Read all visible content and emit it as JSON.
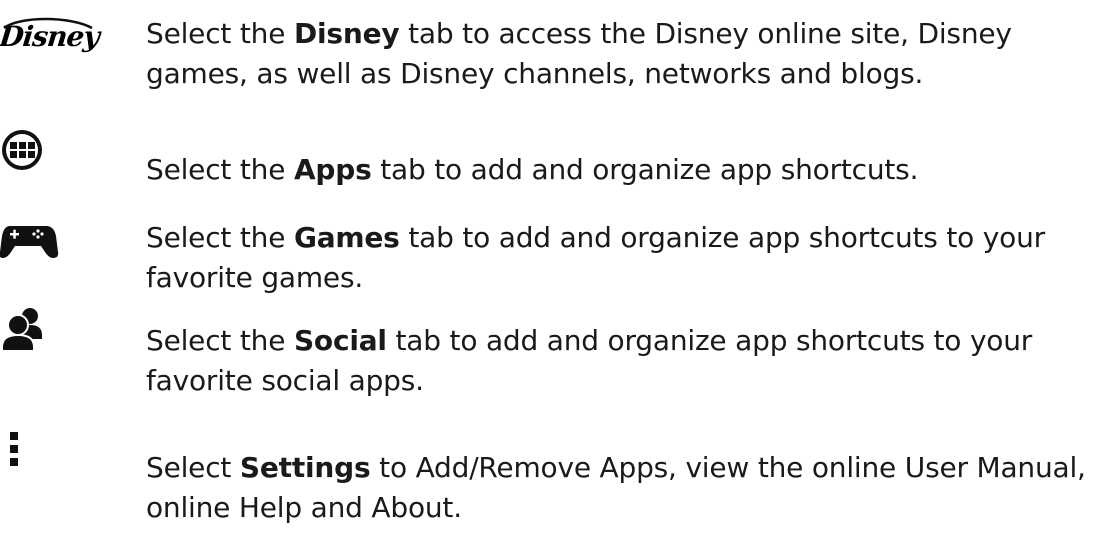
{
  "items": [
    {
      "icon": "disney-logo",
      "logo_text": "Disney",
      "prefix": "Select the ",
      "bold": "Disney",
      "suffix": " tab to access the Disney online site, Disney games, as well as Disney channels, networks and blogs."
    },
    {
      "icon": "apps-grid-icon",
      "prefix": "Select the ",
      "bold": "Apps",
      "suffix": " tab to add and organize app shortcuts."
    },
    {
      "icon": "gamepad-icon",
      "prefix": "Select the ",
      "bold": "Games",
      "suffix": " tab to add and organize app shortcuts to your favorite games."
    },
    {
      "icon": "social-people-icon",
      "prefix": "Select the ",
      "bold": "Social",
      "suffix": " tab to add and organize app shortcuts to your favorite social apps."
    },
    {
      "icon": "settings-menu-icon",
      "prefix": "Select ",
      "bold": "Settings",
      "suffix": " to Add/Remove Apps, view the online User Manual, online Help and About."
    }
  ]
}
